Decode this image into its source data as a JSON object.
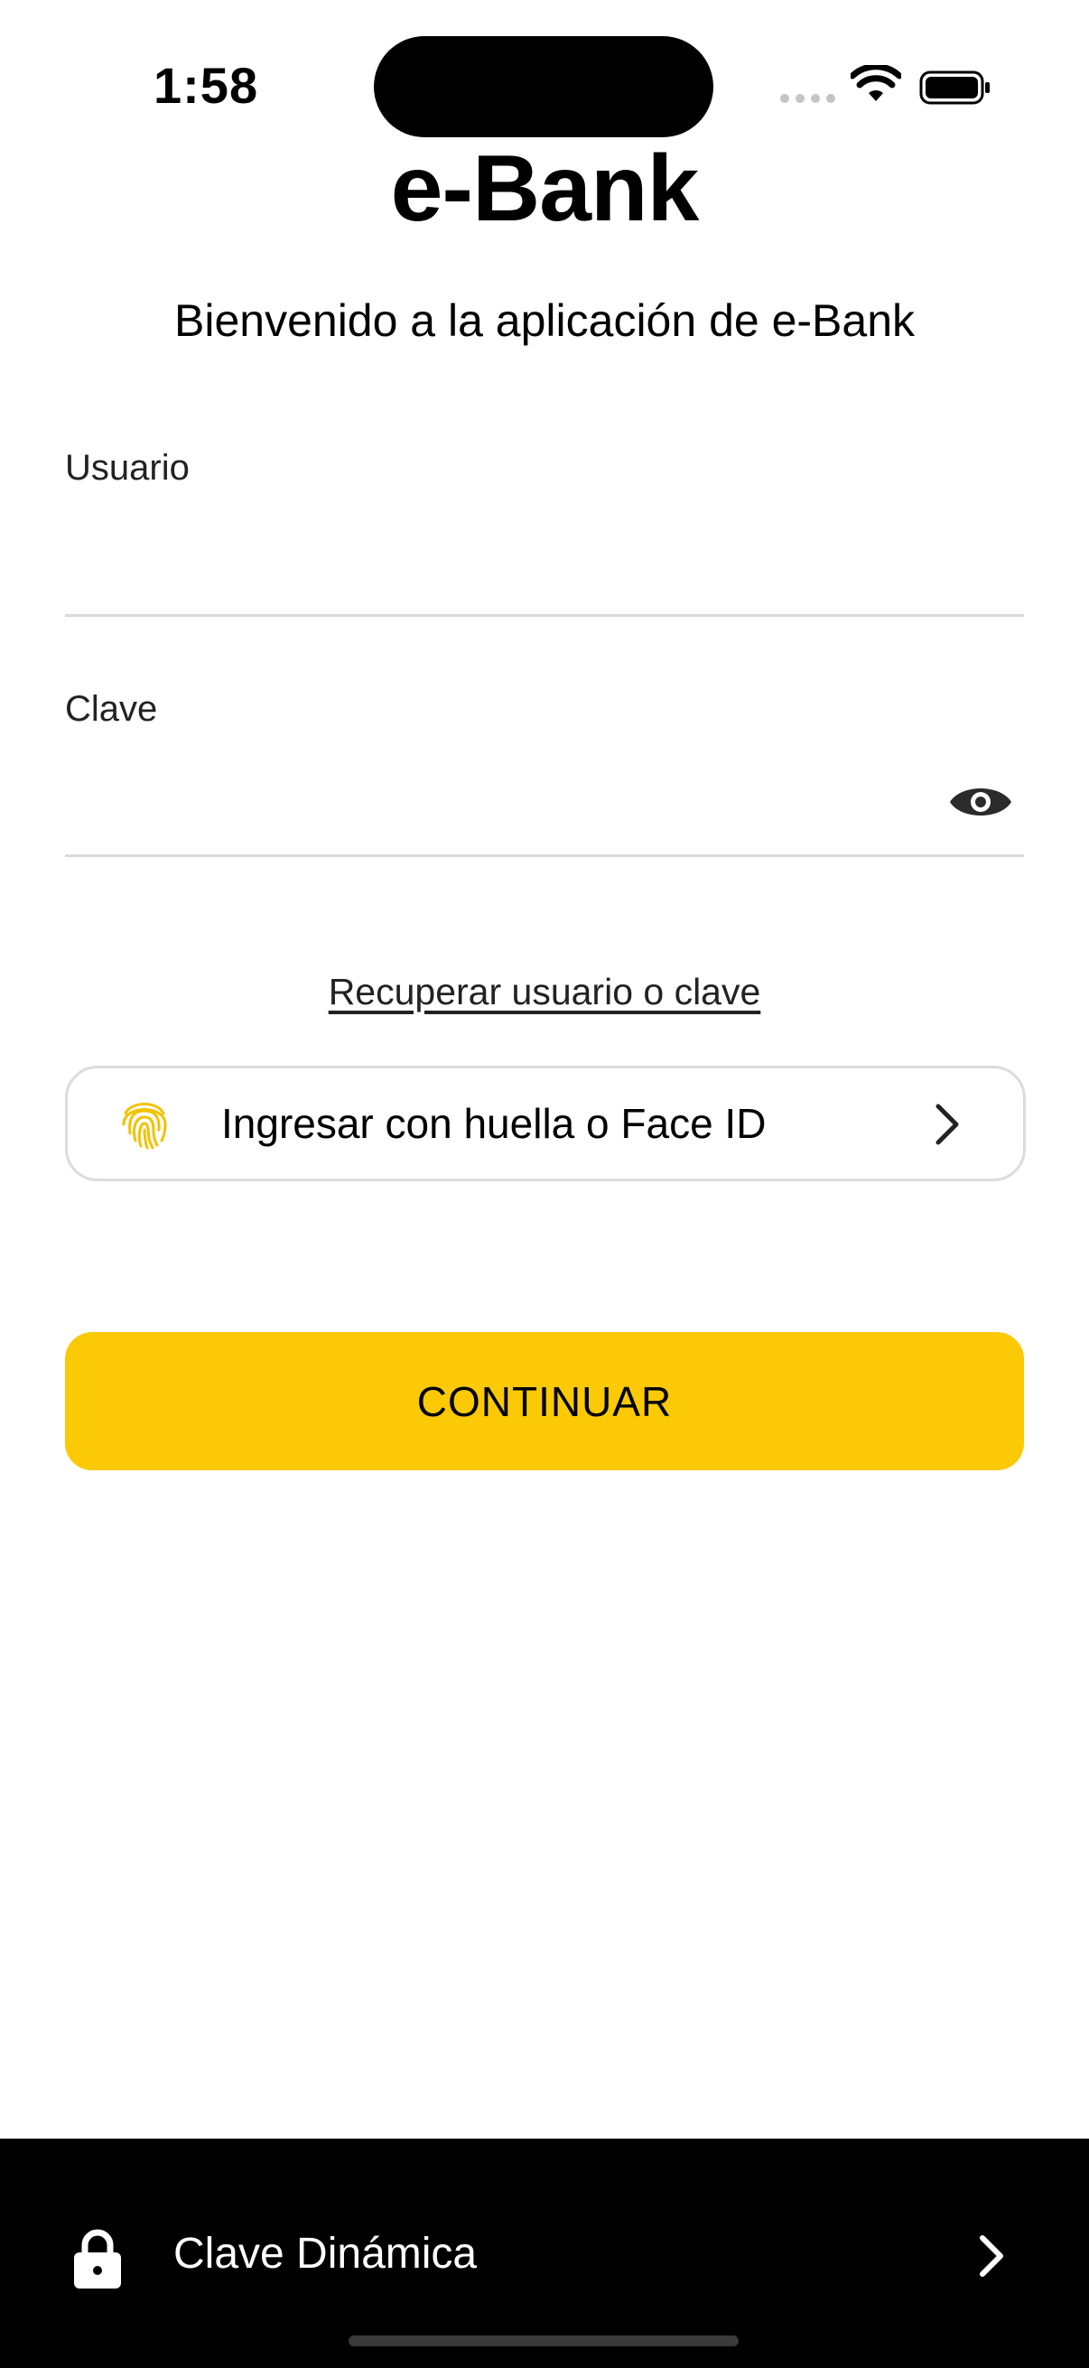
{
  "status_bar": {
    "time": "1:58"
  },
  "app": {
    "title": "e-Bank",
    "welcome": "Bienvenido a la aplicación de e-Bank"
  },
  "form": {
    "user_label": "Usuario",
    "user_value": "",
    "password_label": "Clave",
    "password_value": "",
    "toggle_icon": "eye-icon"
  },
  "links": {
    "recover": "Recuperar usuario o clave"
  },
  "biometric": {
    "label": "Ingresar con huella o Face ID",
    "icon": "fingerprint-icon"
  },
  "actions": {
    "continue_label": "CONTINUAR"
  },
  "footer": {
    "label": "Clave Dinámica",
    "icon": "lock-icon"
  },
  "colors": {
    "accent": "#fbc905",
    "fingerprint": "#f2c200",
    "footer_bg": "#000000"
  }
}
